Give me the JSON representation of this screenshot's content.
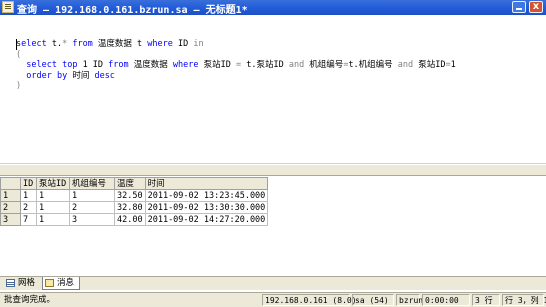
{
  "window": {
    "title": "查询 — 192.168.0.161.bzrun.sa — 无标题1*",
    "close_glyph": "x"
  },
  "editor": {
    "lines": [
      {
        "segments": [
          {
            "t": "select",
            "c": "kw"
          },
          {
            "t": " t.",
            "c": ""
          },
          {
            "t": "*",
            "c": "op"
          },
          {
            "t": " ",
            "c": ""
          },
          {
            "t": "from",
            "c": "kw"
          },
          {
            "t": " 温度数据 t ",
            "c": ""
          },
          {
            "t": "where",
            "c": "kw"
          },
          {
            "t": " ID ",
            "c": ""
          },
          {
            "t": "in",
            "c": "op"
          }
        ]
      },
      {
        "segments": [
          {
            "t": "(",
            "c": "op"
          }
        ]
      },
      {
        "segments": [
          {
            "t": "  ",
            "c": ""
          },
          {
            "t": "select",
            "c": "kw"
          },
          {
            "t": " ",
            "c": ""
          },
          {
            "t": "top",
            "c": "kw"
          },
          {
            "t": " 1 ID ",
            "c": ""
          },
          {
            "t": "from",
            "c": "kw"
          },
          {
            "t": " 温度数据 ",
            "c": ""
          },
          {
            "t": "where",
            "c": "kw"
          },
          {
            "t": " 泵站ID ",
            "c": ""
          },
          {
            "t": "=",
            "c": "op"
          },
          {
            "t": " t.泵站ID ",
            "c": ""
          },
          {
            "t": "and",
            "c": "op"
          },
          {
            "t": " 机组编号",
            "c": ""
          },
          {
            "t": "=",
            "c": "op"
          },
          {
            "t": "t.机组编号 ",
            "c": ""
          },
          {
            "t": "and",
            "c": "op"
          },
          {
            "t": " 泵站ID",
            "c": ""
          },
          {
            "t": "=",
            "c": "op"
          },
          {
            "t": "1",
            "c": ""
          }
        ]
      },
      {
        "segments": [
          {
            "t": "  ",
            "c": ""
          },
          {
            "t": "order by",
            "c": "kw"
          },
          {
            "t": " 时间 ",
            "c": ""
          },
          {
            "t": "desc",
            "c": "kw"
          }
        ]
      },
      {
        "segments": [
          {
            "t": ")",
            "c": "op"
          }
        ]
      }
    ]
  },
  "results": {
    "columns": [
      "ID",
      "泵站ID",
      "机组编号",
      "温度",
      "时间"
    ],
    "rows": [
      {
        "num": "1",
        "cells": [
          "1",
          "1",
          "1",
          "32.50",
          "2011-09-02 13:23:45.000"
        ]
      },
      {
        "num": "2",
        "cells": [
          "2",
          "1",
          "2",
          "32.80",
          "2011-09-02 13:30:30.000"
        ]
      },
      {
        "num": "3",
        "cells": [
          "7",
          "1",
          "3",
          "42.00",
          "2011-09-02 14:27:20.000"
        ]
      }
    ]
  },
  "tabs": {
    "grid_label": "网格",
    "messages_label": "消息"
  },
  "status": {
    "message": "批查询完成。",
    "server": "192.168.0.161 (8.0)",
    "user": "sa (54)",
    "database": "bzrun",
    "elapsed": "0:00:00",
    "row_count": "3 行",
    "position": "行 3，列 1"
  },
  "icons": {
    "app": "query-document-icon",
    "grid_tab": "grid-icon",
    "messages_tab": "message-icon"
  },
  "colors": {
    "titlebar": "#245edb",
    "keyword": "#0000ff",
    "operator": "#808080",
    "chrome": "#ece9d8"
  }
}
